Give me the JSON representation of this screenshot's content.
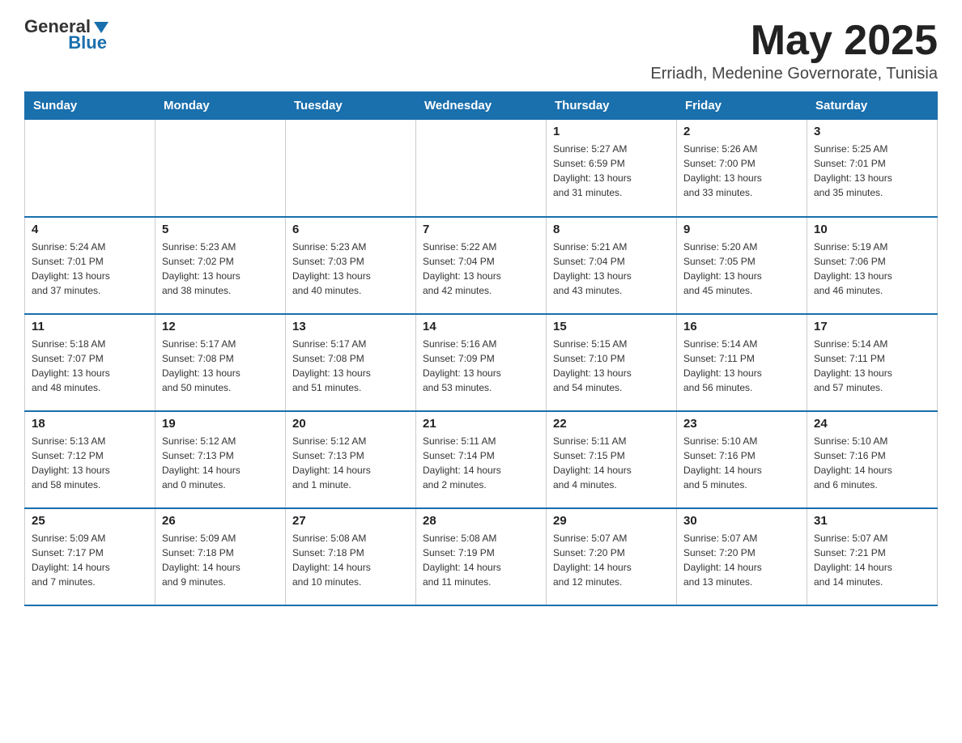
{
  "header": {
    "logo_general": "General",
    "logo_blue": "Blue",
    "month": "May 2025",
    "location": "Erriadh, Medenine Governorate, Tunisia"
  },
  "days_of_week": [
    "Sunday",
    "Monday",
    "Tuesday",
    "Wednesday",
    "Thursday",
    "Friday",
    "Saturday"
  ],
  "weeks": [
    [
      {
        "day": "",
        "info": ""
      },
      {
        "day": "",
        "info": ""
      },
      {
        "day": "",
        "info": ""
      },
      {
        "day": "",
        "info": ""
      },
      {
        "day": "1",
        "info": "Sunrise: 5:27 AM\nSunset: 6:59 PM\nDaylight: 13 hours\nand 31 minutes."
      },
      {
        "day": "2",
        "info": "Sunrise: 5:26 AM\nSunset: 7:00 PM\nDaylight: 13 hours\nand 33 minutes."
      },
      {
        "day": "3",
        "info": "Sunrise: 5:25 AM\nSunset: 7:01 PM\nDaylight: 13 hours\nand 35 minutes."
      }
    ],
    [
      {
        "day": "4",
        "info": "Sunrise: 5:24 AM\nSunset: 7:01 PM\nDaylight: 13 hours\nand 37 minutes."
      },
      {
        "day": "5",
        "info": "Sunrise: 5:23 AM\nSunset: 7:02 PM\nDaylight: 13 hours\nand 38 minutes."
      },
      {
        "day": "6",
        "info": "Sunrise: 5:23 AM\nSunset: 7:03 PM\nDaylight: 13 hours\nand 40 minutes."
      },
      {
        "day": "7",
        "info": "Sunrise: 5:22 AM\nSunset: 7:04 PM\nDaylight: 13 hours\nand 42 minutes."
      },
      {
        "day": "8",
        "info": "Sunrise: 5:21 AM\nSunset: 7:04 PM\nDaylight: 13 hours\nand 43 minutes."
      },
      {
        "day": "9",
        "info": "Sunrise: 5:20 AM\nSunset: 7:05 PM\nDaylight: 13 hours\nand 45 minutes."
      },
      {
        "day": "10",
        "info": "Sunrise: 5:19 AM\nSunset: 7:06 PM\nDaylight: 13 hours\nand 46 minutes."
      }
    ],
    [
      {
        "day": "11",
        "info": "Sunrise: 5:18 AM\nSunset: 7:07 PM\nDaylight: 13 hours\nand 48 minutes."
      },
      {
        "day": "12",
        "info": "Sunrise: 5:17 AM\nSunset: 7:08 PM\nDaylight: 13 hours\nand 50 minutes."
      },
      {
        "day": "13",
        "info": "Sunrise: 5:17 AM\nSunset: 7:08 PM\nDaylight: 13 hours\nand 51 minutes."
      },
      {
        "day": "14",
        "info": "Sunrise: 5:16 AM\nSunset: 7:09 PM\nDaylight: 13 hours\nand 53 minutes."
      },
      {
        "day": "15",
        "info": "Sunrise: 5:15 AM\nSunset: 7:10 PM\nDaylight: 13 hours\nand 54 minutes."
      },
      {
        "day": "16",
        "info": "Sunrise: 5:14 AM\nSunset: 7:11 PM\nDaylight: 13 hours\nand 56 minutes."
      },
      {
        "day": "17",
        "info": "Sunrise: 5:14 AM\nSunset: 7:11 PM\nDaylight: 13 hours\nand 57 minutes."
      }
    ],
    [
      {
        "day": "18",
        "info": "Sunrise: 5:13 AM\nSunset: 7:12 PM\nDaylight: 13 hours\nand 58 minutes."
      },
      {
        "day": "19",
        "info": "Sunrise: 5:12 AM\nSunset: 7:13 PM\nDaylight: 14 hours\nand 0 minutes."
      },
      {
        "day": "20",
        "info": "Sunrise: 5:12 AM\nSunset: 7:13 PM\nDaylight: 14 hours\nand 1 minute."
      },
      {
        "day": "21",
        "info": "Sunrise: 5:11 AM\nSunset: 7:14 PM\nDaylight: 14 hours\nand 2 minutes."
      },
      {
        "day": "22",
        "info": "Sunrise: 5:11 AM\nSunset: 7:15 PM\nDaylight: 14 hours\nand 4 minutes."
      },
      {
        "day": "23",
        "info": "Sunrise: 5:10 AM\nSunset: 7:16 PM\nDaylight: 14 hours\nand 5 minutes."
      },
      {
        "day": "24",
        "info": "Sunrise: 5:10 AM\nSunset: 7:16 PM\nDaylight: 14 hours\nand 6 minutes."
      }
    ],
    [
      {
        "day": "25",
        "info": "Sunrise: 5:09 AM\nSunset: 7:17 PM\nDaylight: 14 hours\nand 7 minutes."
      },
      {
        "day": "26",
        "info": "Sunrise: 5:09 AM\nSunset: 7:18 PM\nDaylight: 14 hours\nand 9 minutes."
      },
      {
        "day": "27",
        "info": "Sunrise: 5:08 AM\nSunset: 7:18 PM\nDaylight: 14 hours\nand 10 minutes."
      },
      {
        "day": "28",
        "info": "Sunrise: 5:08 AM\nSunset: 7:19 PM\nDaylight: 14 hours\nand 11 minutes."
      },
      {
        "day": "29",
        "info": "Sunrise: 5:07 AM\nSunset: 7:20 PM\nDaylight: 14 hours\nand 12 minutes."
      },
      {
        "day": "30",
        "info": "Sunrise: 5:07 AM\nSunset: 7:20 PM\nDaylight: 14 hours\nand 13 minutes."
      },
      {
        "day": "31",
        "info": "Sunrise: 5:07 AM\nSunset: 7:21 PM\nDaylight: 14 hours\nand 14 minutes."
      }
    ]
  ]
}
